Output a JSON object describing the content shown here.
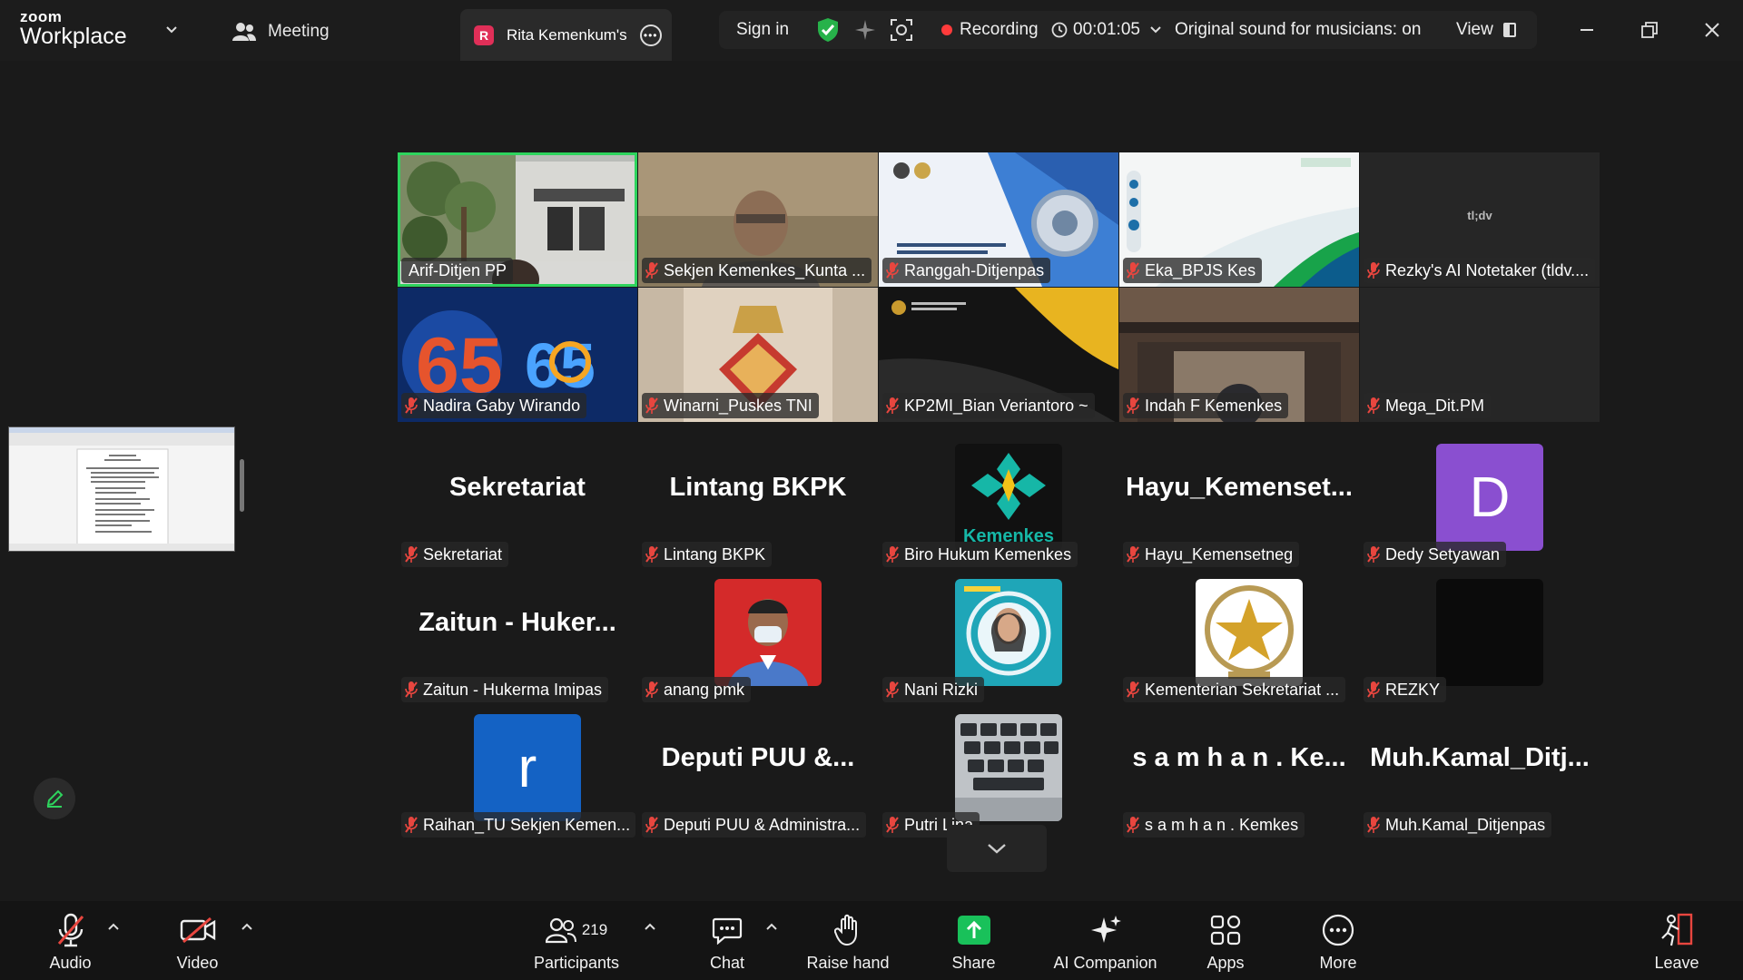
{
  "titlebar": {
    "brand_top": "zoom",
    "brand_bottom": "Workplace",
    "meeting_label": "Meeting",
    "active_tab": {
      "letter": "R",
      "label": "Rita Kemenkum's"
    },
    "sign_in": "Sign in",
    "recording_label": "Recording",
    "timer": "00:01:05",
    "original_sound": "Original sound for musicians: on",
    "view_label": "View"
  },
  "colors": {
    "accent_green": "#2ed45d",
    "recording_red": "#ff3b3b",
    "mute_red": "#e8463f",
    "share_green": "#19c15a",
    "avatar_purple": "#8a4fd0",
    "avatar_blue": "#1462c4"
  },
  "grid": {
    "row1": [
      {
        "name": "Arif-Ditjen PP",
        "muted": false,
        "speaking": true
      },
      {
        "name": "Sekjen Kemenkes_Kunta ...",
        "muted": true
      },
      {
        "name": "Ranggah-Ditjenpas",
        "muted": true
      },
      {
        "name": "Eka_BPJS Kes",
        "muted": true
      },
      {
        "name": "Rezky's AI Notetaker (tldv....",
        "muted": true,
        "tile_text": "tl;dv"
      }
    ],
    "row2": [
      {
        "name": "Nadira Gaby Wirando",
        "muted": true
      },
      {
        "name": "Winarni_Puskes TNI",
        "muted": true
      },
      {
        "name": "KP2MI_Bian Veriantoro ~",
        "muted": true
      },
      {
        "name": "Indah F Kemenkes",
        "muted": true
      },
      {
        "name": "Mega_Dit.PM",
        "muted": true
      }
    ],
    "row3": [
      {
        "name": "Sekretariat",
        "display": "Sekretariat",
        "muted": true
      },
      {
        "name": "Lintang BKPK",
        "display": "Lintang BKPK",
        "muted": true
      },
      {
        "name": "Biro Hukum Kemenkes",
        "avatar_text": "Kemenkes",
        "muted": true
      },
      {
        "name": "Hayu_Kemensetneg",
        "display": "Hayu_Kemenset...",
        "muted": true
      },
      {
        "name": "Dedy Setyawan",
        "avatar_letter": "D",
        "muted": true
      }
    ],
    "row4": [
      {
        "name": "Zaitun - Hukerma Imipas",
        "display": "Zaitun - Huker...",
        "muted": true
      },
      {
        "name": "anang pmk",
        "muted": true
      },
      {
        "name": "Nani Rizki",
        "muted": true
      },
      {
        "name": "Kementerian Sekretariat ...",
        "muted": true
      },
      {
        "name": "REZKY",
        "muted": true
      }
    ],
    "row5": [
      {
        "name": "Raihan_TU Sekjen Kemen...",
        "avatar_letter": "r",
        "muted": true
      },
      {
        "name": "Deputi PUU & Administra...",
        "display": "Deputi PUU &...",
        "muted": true
      },
      {
        "name": "Putri Lina",
        "muted": true
      },
      {
        "name": "s a m h a n . Kemkes",
        "display": "s a m h a n . Ke...",
        "muted": true
      },
      {
        "name": "Muh.Kamal_Ditjenpas",
        "display": "Muh.Kamal_Ditj...",
        "muted": true
      }
    ]
  },
  "toolbar": {
    "audio": "Audio",
    "video": "Video",
    "participants": "Participants",
    "participants_count": "219",
    "chat": "Chat",
    "raise_hand": "Raise hand",
    "share": "Share",
    "ai_companion": "AI Companion",
    "apps": "Apps",
    "more": "More",
    "leave": "Leave"
  }
}
